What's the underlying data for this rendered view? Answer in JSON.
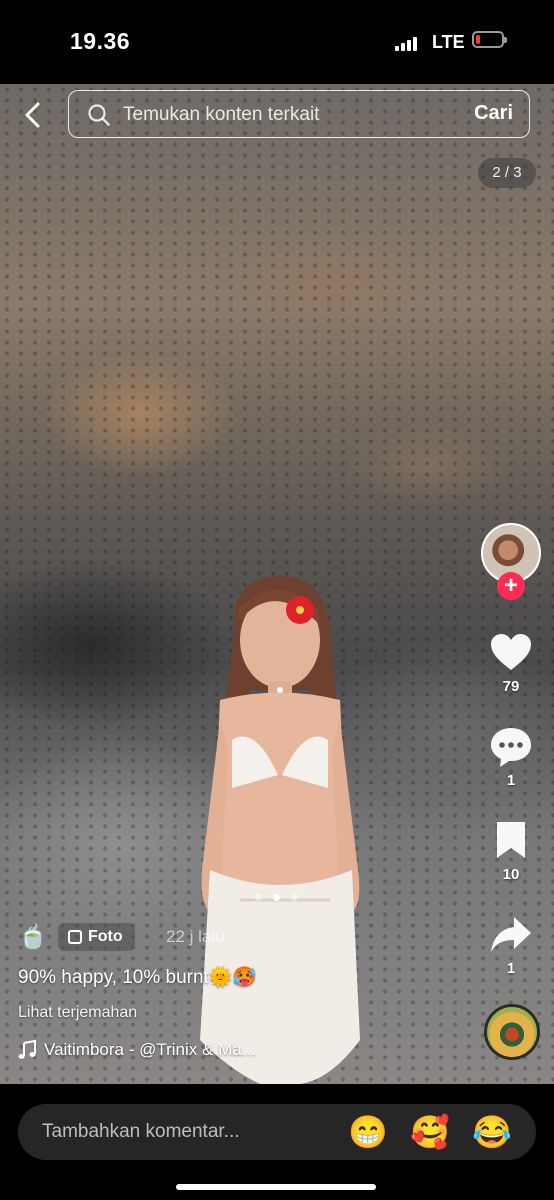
{
  "status_bar": {
    "time": "19.36",
    "network": "LTE"
  },
  "search": {
    "placeholder": "Temukan konten terkait",
    "submit_label": "Cari"
  },
  "carousel": {
    "position": "2 / 3",
    "current": 2,
    "total": 3
  },
  "post": {
    "author_emoji": "🍵",
    "type_badge": "Foto",
    "time_ago": "22 j lalu",
    "caption": "90% happy, 10% burnt🌞🥵",
    "translate_link": "Lihat terjemahan",
    "music": "Vaitimbora - @Trinix & Ma..."
  },
  "actions": {
    "likes": "79",
    "comments": "1",
    "saves": "10",
    "shares": "1"
  },
  "comment_bar": {
    "placeholder": "Tambahkan komentar...",
    "emojis": [
      "😁",
      "🥰",
      "😂"
    ]
  },
  "colors": {
    "follow_accent": "#fe2c55",
    "battery_low": "#ff3b30"
  }
}
